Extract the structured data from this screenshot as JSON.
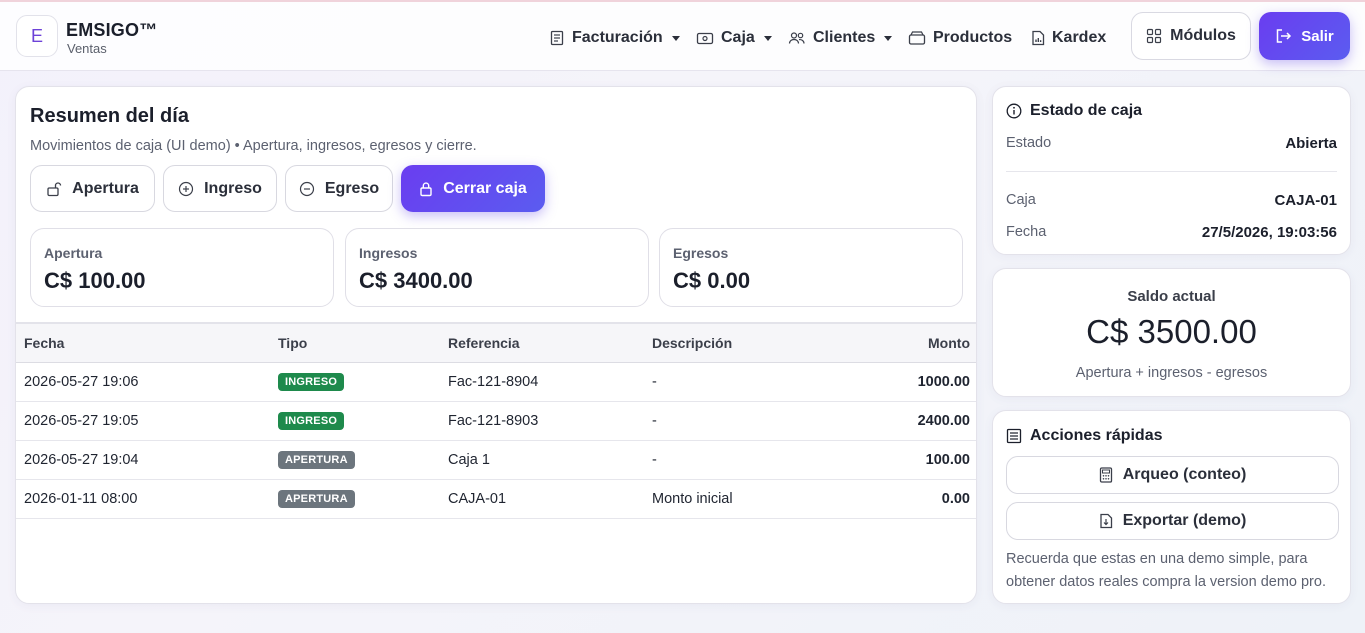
{
  "brand": {
    "letter": "E",
    "name": "EMSIGO™",
    "subtitle": "Ventas"
  },
  "nav": [
    {
      "label": "Facturación",
      "icon": "receipt-icon",
      "dropdown": true
    },
    {
      "label": "Caja",
      "icon": "cash-icon",
      "dropdown": true
    },
    {
      "label": "Clientes",
      "icon": "people-icon",
      "dropdown": true
    },
    {
      "label": "Productos",
      "icon": "box-icon",
      "dropdown": false
    },
    {
      "label": "Kardex",
      "icon": "chart-file-icon",
      "dropdown": false
    }
  ],
  "header_buttons": {
    "modulos": "Módulos",
    "salir": "Salir"
  },
  "resumen": {
    "title": "Resumen del día",
    "subtitle": "Movimientos de caja (UI demo) • Apertura, ingresos, egresos y cierre.",
    "actions": {
      "apertura": "Apertura",
      "ingreso": "Ingreso",
      "egreso": "Egreso",
      "cerrar": "Cerrar caja"
    },
    "stats": [
      {
        "label": "Apertura",
        "value": "C$ 100.00"
      },
      {
        "label": "Ingresos",
        "value": "C$ 3400.00"
      },
      {
        "label": "Egresos",
        "value": "C$ 0.00"
      }
    ]
  },
  "table": {
    "columns": [
      "Fecha",
      "Tipo",
      "Referencia",
      "Descripción",
      "Monto"
    ],
    "rows": [
      {
        "fecha": "2026-05-27 19:06",
        "tipo": "INGRESO",
        "referencia": "Fac-121-8904",
        "descripcion": "-",
        "monto": "1000.00"
      },
      {
        "fecha": "2026-05-27 19:05",
        "tipo": "INGRESO",
        "referencia": "Fac-121-8903",
        "descripcion": "-",
        "monto": "2400.00"
      },
      {
        "fecha": "2026-05-27 19:04",
        "tipo": "APERTURA",
        "referencia": "Caja 1",
        "descripcion": "-",
        "monto": "100.00"
      },
      {
        "fecha": "2026-01-11 08:00",
        "tipo": "APERTURA",
        "referencia": "CAJA-01",
        "descripcion": "Monto inicial",
        "monto": "0.00"
      }
    ]
  },
  "estado": {
    "title": "Estado de caja",
    "estado_label": "Estado",
    "estado_value": "Abierta",
    "caja_label": "Caja",
    "caja_value": "CAJA-01",
    "fecha_label": "Fecha",
    "fecha_value": "27/5/2026, 19:03:56"
  },
  "saldo": {
    "label": "Saldo actual",
    "value": "C$ 3500.00",
    "hint": "Apertura + ingresos - egresos"
  },
  "acciones": {
    "title": "Acciones rápidas",
    "arqueo": "Arqueo (conteo)",
    "exportar": "Exportar (demo)",
    "note": "Recuerda que estas en una demo simple, para obtener datos reales compra la version demo pro."
  },
  "colors": {
    "accent": "#6a3df0",
    "ingreso_tag": "#1e8a4c",
    "apertura_tag": "#6c757d"
  }
}
